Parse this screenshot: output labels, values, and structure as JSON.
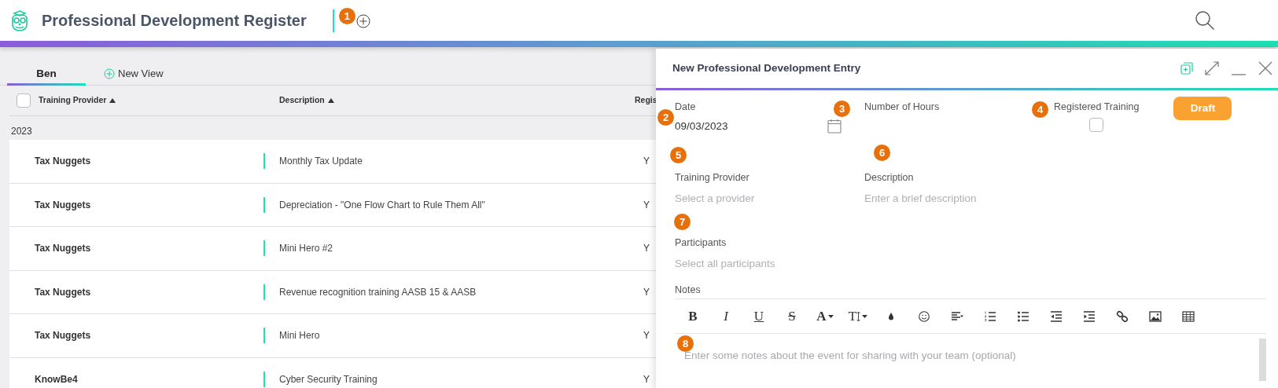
{
  "app": {
    "title": "Professional Development Register",
    "callout": "1"
  },
  "tabs": [
    {
      "label": "Ben",
      "selected": true,
      "kind": "view"
    },
    {
      "label": "New View",
      "selected": false,
      "kind": "add"
    }
  ],
  "table": {
    "select_all": {
      "checked": false
    },
    "columns": [
      {
        "label": "Training Provider",
        "sorted": true
      },
      {
        "label": "Description",
        "sorted": true
      },
      {
        "label": "Regis"
      }
    ],
    "group": "2023",
    "rows": [
      {
        "provider": "Tax Nuggets",
        "description": "Monthly Tax Update",
        "column_3": "Y"
      },
      {
        "provider": "Tax Nuggets",
        "description": "Depreciation - \"One Flow Chart to Rule Them All\"",
        "column_3": "Y"
      },
      {
        "provider": "Tax Nuggets",
        "description": "Mini Hero #2",
        "column_3": "Y"
      },
      {
        "provider": "Tax Nuggets",
        "description": "Revenue recognition training AASB 15 & AASB",
        "column_3": "Y"
      },
      {
        "provider": "Tax Nuggets",
        "description": "Mini Hero",
        "column_3": "Y"
      },
      {
        "provider": "KnowBe4",
        "description": "Cyber Security Training",
        "column_3": "Y"
      }
    ]
  },
  "panel": {
    "title": "New Professional Development Entry",
    "date": {
      "label": "Date",
      "value": "09/03/2023",
      "callout": "2"
    },
    "hours": {
      "label": "Number of Hours",
      "callout": "3"
    },
    "registered": {
      "label": "Registered Training",
      "checked": false,
      "callout": "4"
    },
    "status_button": "Draft",
    "provider": {
      "label": "Training Provider",
      "placeholder": "Select a provider",
      "callout": "5"
    },
    "description": {
      "label": "Description",
      "placeholder": "Enter a brief description",
      "callout": "6"
    },
    "participants": {
      "label": "Participants",
      "placeholder": "Select all participants",
      "callout": "7"
    },
    "notes": {
      "label": "Notes",
      "placeholder": "Enter some notes about the event for sharing with your team (optional)",
      "callout": "8",
      "toolbar": [
        {
          "kind": "bold",
          "label": "B"
        },
        {
          "kind": "italic",
          "label": "I"
        },
        {
          "kind": "underline",
          "label": "U"
        },
        {
          "kind": "strike",
          "label": "S"
        },
        {
          "kind": "font",
          "label": "A"
        },
        {
          "kind": "size",
          "label": "T"
        },
        {
          "kind": "drop"
        },
        {
          "kind": "smiley"
        },
        {
          "kind": "align"
        },
        {
          "kind": "numbered"
        },
        {
          "kind": "bullets"
        },
        {
          "kind": "outdent"
        },
        {
          "kind": "indent"
        },
        {
          "kind": "link"
        },
        {
          "kind": "image"
        },
        {
          "kind": "table"
        }
      ]
    }
  }
}
